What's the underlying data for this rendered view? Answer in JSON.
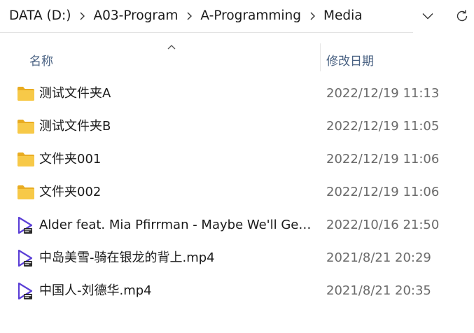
{
  "address_bar": {
    "breadcrumbs": [
      "DATA (D:)",
      "A03-Program",
      "A-Programming",
      "Media"
    ]
  },
  "columns": {
    "name": "名称",
    "date_modified": "修改日期"
  },
  "files": [
    {
      "name": "测试文件夹A",
      "date": "2022/12/19 11:13",
      "type": "folder"
    },
    {
      "name": "测试文件夹B",
      "date": "2022/12/19 11:05",
      "type": "folder"
    },
    {
      "name": "文件夹001",
      "date": "2022/12/19 11:06",
      "type": "folder"
    },
    {
      "name": "文件夹002",
      "date": "2022/12/19 11:06",
      "type": "folder"
    },
    {
      "name": "Alder feat. Mia Pfirrman - Maybe We'll Get ...",
      "date": "2022/10/16 21:50",
      "type": "mp4"
    },
    {
      "name": "中岛美雪-骑在银龙的背上.mp4",
      "date": "2021/8/21 20:29",
      "type": "mp4"
    },
    {
      "name": "中国人-刘德华.mp4",
      "date": "2021/8/21 20:35",
      "type": "mp4"
    }
  ],
  "colors": {
    "folder": "#f7c948",
    "folder_dark": "#e9ac21",
    "video_accent": "#5b3fd6",
    "header_text": "#4a6283"
  }
}
